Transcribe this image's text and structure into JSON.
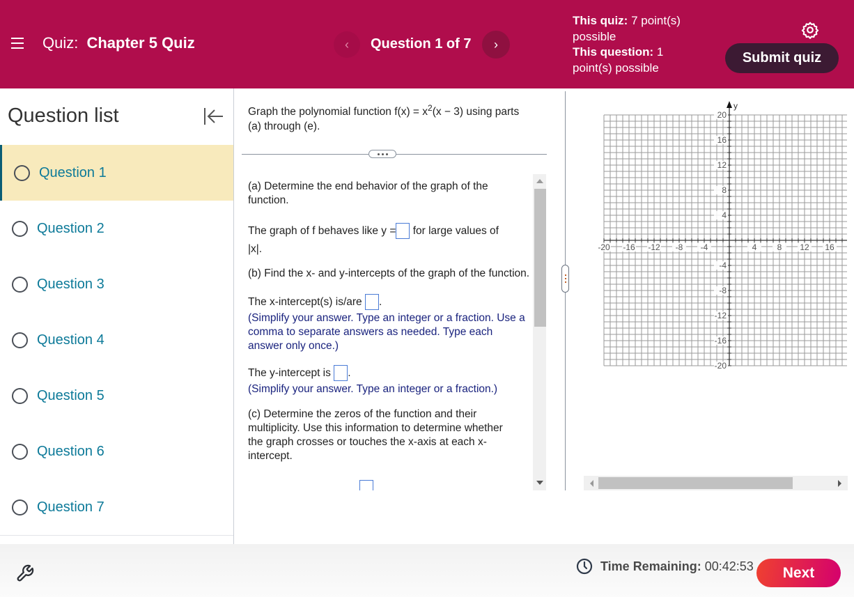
{
  "header": {
    "menu_icon": "hamburger-icon",
    "quiz_prefix": "Quiz:",
    "quiz_name": "Chapter 5 Quiz",
    "nav_prev_icon": "chevron-left-icon",
    "nav_label": "Question 1 of 7",
    "nav_next_icon": "chevron-right-icon",
    "quiz_points_label": "This quiz:",
    "quiz_points_value": "7 point(s) possible",
    "question_points_label": "This question:",
    "question_points_value": "1 point(s) possible",
    "settings_icon": "gear-icon",
    "submit_label": "Submit quiz"
  },
  "sidebar": {
    "title": "Question list",
    "collapse_icon": "collapse-left-icon",
    "items": [
      {
        "label": "Question 1",
        "active": true
      },
      {
        "label": "Question 2",
        "active": false
      },
      {
        "label": "Question 3",
        "active": false
      },
      {
        "label": "Question 4",
        "active": false
      },
      {
        "label": "Question 5",
        "active": false
      },
      {
        "label": "Question 6",
        "active": false
      },
      {
        "label": "Question 7",
        "active": false
      }
    ]
  },
  "question": {
    "stem_before": "Graph the polynomial function f(x) = x",
    "stem_sup": "2",
    "stem_after": "(x − 3) using parts (a) through (e).",
    "more_icon": "ellipsis-icon",
    "part_a": "(a) Determine the end behavior of the graph of the function.",
    "part_a_answer_before": "The graph of f behaves like y =",
    "part_a_answer_after": "for large values of",
    "part_a_answer_tail": "|x|.",
    "part_a_value": "",
    "part_b": "(b) Find the x- and y-intercepts of the graph of the function.",
    "x_intercept_label": "The x-intercept(s) is/are",
    "x_intercept_value": "",
    "x_intercept_hint": "(Simplify your answer. Type an integer or a fraction. Use a comma to separate answers as needed. Type each answer only once.)",
    "y_intercept_label": "The y-intercept is",
    "y_intercept_value": "",
    "y_intercept_hint": "(Simplify your answer. Type an integer or a fraction.)",
    "part_c": "(c) Determine the zeros of the function and their multiplicity. Use this information to determine whether the graph crosses or touches the x-axis at each x-intercept."
  },
  "graph": {
    "y_axis_label": "y",
    "x_range": [
      -20,
      20
    ],
    "y_range": [
      -20,
      20
    ],
    "major_step": 4,
    "minor_step": 1,
    "x_tick_labels": [
      "-20",
      "-16",
      "-12",
      "-8",
      "-4",
      "4",
      "8",
      "12",
      "16"
    ],
    "y_tick_labels": [
      "20",
      "16",
      "12",
      "8",
      "4",
      "-4",
      "-8",
      "-12",
      "-16",
      "-20"
    ]
  },
  "footer": {
    "tools_icon": "wrench-icon",
    "clock_icon": "clock-icon",
    "time_label": "Time Remaining:",
    "time_value": "00:42:53",
    "next_label": "Next"
  }
}
